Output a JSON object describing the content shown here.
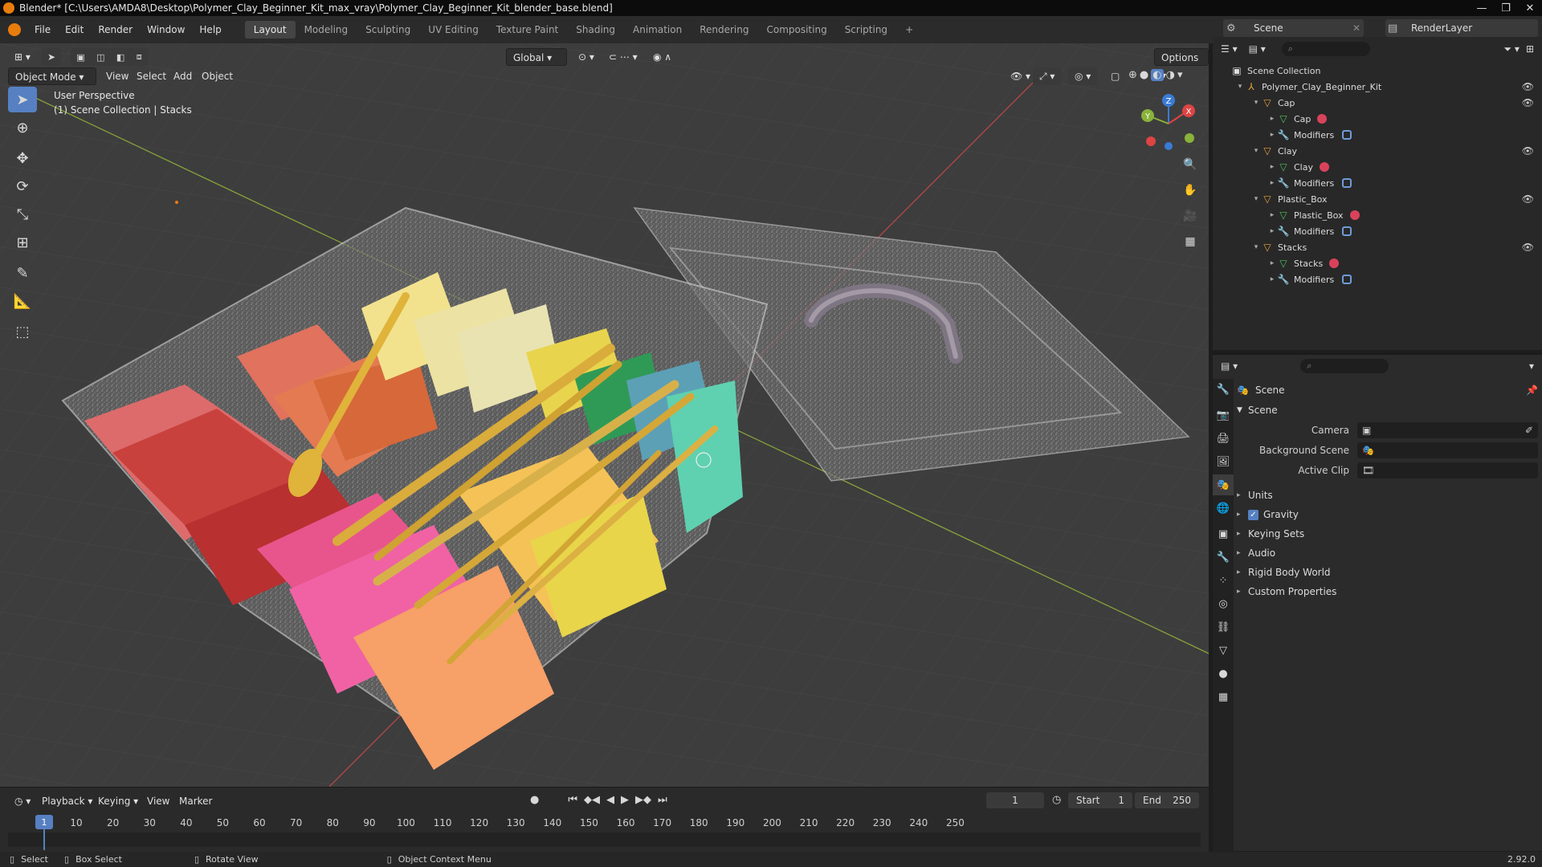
{
  "window": {
    "title": "Blender* [C:\\Users\\AMDA8\\Desktop\\Polymer_Clay_Beginner_Kit_max_vray\\Polymer_Clay_Beginner_Kit_blender_base.blend]",
    "minimize": "—",
    "maximize": "❐",
    "close": "✕"
  },
  "menu": {
    "items": [
      "File",
      "Edit",
      "Render",
      "Window",
      "Help"
    ],
    "workspaces": [
      "Layout",
      "Modeling",
      "Sculpting",
      "UV Editing",
      "Texture Paint",
      "Shading",
      "Animation",
      "Rendering",
      "Compositing",
      "Scripting"
    ],
    "add_workspace": "+",
    "scene": "Scene",
    "render_layer": "RenderLayer"
  },
  "viewport": {
    "mode": "Object Mode",
    "menus": [
      "View",
      "Select",
      "Add",
      "Object"
    ],
    "orientation": "Global",
    "options": "Options",
    "info_line1": "User Perspective",
    "info_line2": "(1) Scene Collection | Stacks",
    "gizmo_x": "X",
    "gizmo_y": "Y",
    "gizmo_z": "Z"
  },
  "timeline": {
    "menus": [
      "Playback",
      "Keying",
      "View",
      "Marker"
    ],
    "current_frame": "1",
    "start_label": "Start",
    "start": "1",
    "end_label": "End",
    "end": "250",
    "ticks": [
      "1",
      "10",
      "20",
      "30",
      "40",
      "50",
      "60",
      "70",
      "80",
      "90",
      "100",
      "110",
      "120",
      "130",
      "140",
      "150",
      "160",
      "170",
      "180",
      "190",
      "200",
      "210",
      "220",
      "230",
      "240",
      "250"
    ]
  },
  "statusbar": {
    "select": "Select",
    "box_select": "Box Select",
    "rotate": "Rotate View",
    "context": "Object Context Menu",
    "version": "2.92.0"
  },
  "outliner": {
    "root": "Scene Collection",
    "rows": [
      {
        "label": "Polymer_Clay_Beginner_Kit",
        "depth": 1,
        "icon": "empty",
        "eye": true
      },
      {
        "label": "Cap",
        "depth": 2,
        "icon": "object",
        "eye": true
      },
      {
        "label": "Cap",
        "depth": 3,
        "icon": "mesh",
        "eye": false
      },
      {
        "label": "Modifiers",
        "depth": 3,
        "icon": "wrench",
        "eye": false
      },
      {
        "label": "Clay",
        "depth": 2,
        "icon": "object",
        "eye": true
      },
      {
        "label": "Clay",
        "depth": 3,
        "icon": "mesh",
        "eye": false
      },
      {
        "label": "Modifiers",
        "depth": 3,
        "icon": "wrench",
        "eye": false
      },
      {
        "label": "Plastic_Box",
        "depth": 2,
        "icon": "object",
        "eye": true
      },
      {
        "label": "Plastic_Box",
        "depth": 3,
        "icon": "mesh",
        "eye": false
      },
      {
        "label": "Modifiers",
        "depth": 3,
        "icon": "wrench",
        "eye": false
      },
      {
        "label": "Stacks",
        "depth": 2,
        "icon": "object",
        "eye": true
      },
      {
        "label": "Stacks",
        "depth": 3,
        "icon": "mesh",
        "eye": false
      },
      {
        "label": "Modifiers",
        "depth": 3,
        "icon": "wrench",
        "eye": false
      }
    ]
  },
  "properties": {
    "context": "Scene",
    "panel": "Scene",
    "camera_label": "Camera",
    "bg_scene_label": "Background Scene",
    "active_clip_label": "Active Clip",
    "subpanels": [
      "Units",
      "Gravity",
      "Keying Sets",
      "Audio",
      "Rigid Body World",
      "Custom Properties"
    ]
  },
  "colors": {
    "accent": "#5680c2",
    "object_orange": "#e8a33b",
    "mesh_green": "#4fc25a",
    "material_red": "#d9425b"
  }
}
